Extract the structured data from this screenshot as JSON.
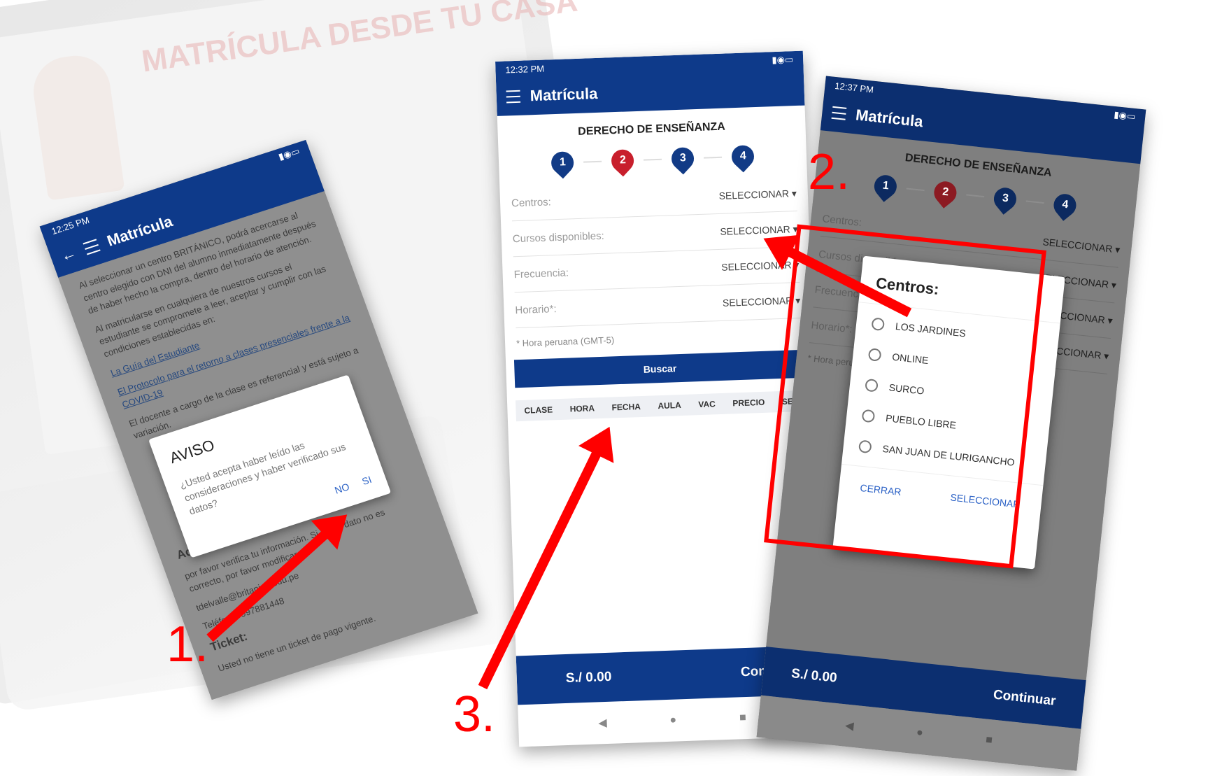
{
  "screen1": {
    "time": "12:25 PM",
    "title": "Matrícula",
    "paragraphs": [
      "Al seleccionar un centro BRITÁNICO, podrá acercarse al centro elegido con DNI del alumno inmediatamente después de haber hecho la compra, dentro del horario de atención.",
      "Al matricularse en cualquiera de nuestros cursos el estudiante se compromete a leer, aceptar y cumplir con las condiciones establecidas en:",
      "La Guía del Estudiante",
      "El Protocolo para el retorno a clases presenciales frente a la COVID-19",
      "El docente a cargo de la clase es referencial y está sujeto a variación."
    ],
    "section_actualizar": "Actualiza tus datos",
    "update_note": "por favor verifica tu información. Si algún dato no es correcto, por favor modificar.",
    "email": "tdelvalle@britanico.edu.pe",
    "phone_label": "Teléfono:",
    "phone": "997881448",
    "ticket_heading": "Ticket:",
    "ticket_note": "Usted no tiene un ticket de pago vigente.",
    "dialog": {
      "title": "AVISO",
      "message": "¿Usted acepta haber leído las consideraciones y haber verificado sus datos?",
      "no": "NO",
      "yes": "SI"
    }
  },
  "screen2": {
    "time": "12:32 PM",
    "title": "Matrícula",
    "section_title": "DERECHO DE ENSEÑANZA",
    "steps": [
      "1",
      "2",
      "3",
      "4"
    ],
    "rows": [
      {
        "label": "Centros:",
        "value": "SELECCIONAR"
      },
      {
        "label": "Cursos disponibles:",
        "value": "SELECCIONAR"
      },
      {
        "label": "Frecuencia:",
        "value": "SELECCIONAR"
      },
      {
        "label": "Horario*:",
        "value": "SELECCIONAR"
      }
    ],
    "tz_note": "* Hora peruana (GMT-5)",
    "search_button": "Buscar",
    "table_headers": [
      "CLASE",
      "HORA",
      "FECHA",
      "AULA",
      "VAC",
      "PRECIO",
      "SEL"
    ],
    "total": "S./ 0.00",
    "continue": "Continuar"
  },
  "screen3": {
    "time": "12:37 PM",
    "title": "Matrícula",
    "section_title": "DERECHO DE ENSEÑANZA",
    "steps": [
      "1",
      "2",
      "3",
      "4"
    ],
    "row_labels": [
      "Centros:",
      "Cursos disponibles:",
      "Frecuencia:",
      "Horario*:"
    ],
    "row_value": "SELECCIONAR",
    "tz_note": "* Hora peruana (GMT-5)",
    "total": "S./ 0.00",
    "continue": "Continuar",
    "dialog": {
      "title": "Centros:",
      "options": [
        "LOS JARDINES",
        "ONLINE",
        "SURCO",
        "PUEBLO LIBRE",
        "SAN JUAN DE LURIGANCHO"
      ],
      "close": "CERRAR",
      "select": "SELECCIONAR"
    }
  },
  "annotations": {
    "step1": "1.",
    "step2": "2.",
    "step3": "3."
  },
  "background": {
    "heading": "MATRÍCULA DESDE TU CASA"
  },
  "colors": {
    "primary_blue": "#0e3a8a",
    "step_red": "#c81f2c",
    "annotation_red": "#ff0000",
    "link_blue": "#2c62c6"
  }
}
